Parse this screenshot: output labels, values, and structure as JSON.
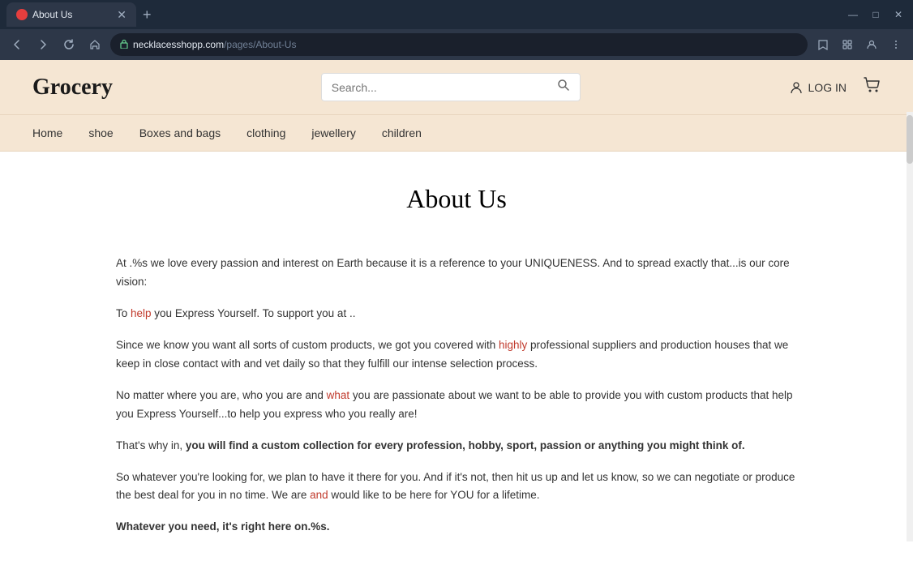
{
  "browser": {
    "tab": {
      "title": "About Us",
      "favicon_text": "●"
    },
    "url": {
      "protocol_icon": "🔒",
      "domain": "necklacesshopp.com",
      "path": "/pages/About-Us"
    },
    "nav_buttons": {
      "back": "←",
      "forward": "→",
      "refresh": "↻",
      "home": "⌂"
    },
    "window_controls": {
      "minimize": "—",
      "maximize": "□",
      "close": "✕"
    }
  },
  "header": {
    "logo": "Grocery",
    "search_placeholder": "Search...",
    "login_label": "LOG IN",
    "cart_icon": "cart"
  },
  "nav": {
    "items": [
      {
        "label": "Home"
      },
      {
        "label": "shoe"
      },
      {
        "label": "Boxes and bags"
      },
      {
        "label": "clothing"
      },
      {
        "label": "jewellery"
      },
      {
        "label": "children"
      }
    ]
  },
  "page": {
    "title": "About Us",
    "paragraphs": [
      {
        "id": "p1",
        "text": "At .%s we love every passion and interest on Earth because it is a reference to your UNIQUENESS. And to spread exactly that...is our core vision:"
      },
      {
        "id": "p2",
        "text": "To help you Express Yourself. To support you at .."
      },
      {
        "id": "p3",
        "text": "Since we know you want all sorts of custom products, we got you covered with highly professional suppliers and production houses that we keep in close contact with and vet daily so that they fulfill our intense selection process."
      },
      {
        "id": "p4",
        "text": "No matter where you are, who you are and what you are passionate about we want to be able to provide you with custom products that help you Express Yourself...to help you express who you really are!"
      },
      {
        "id": "p5",
        "text": "That's why in, you will find a custom collection for every profession, hobby, sport, passion or anything you might think of."
      },
      {
        "id": "p6",
        "text": "So whatever you're looking for, we plan to have it there for you. And if it's not, then hit us up and let us know, so we can negotiate or produce the best deal for you in no time. We are and would like to be here for YOU for a lifetime."
      },
      {
        "id": "p7",
        "text": "Whatever you need, it's right here on.%s."
      }
    ]
  }
}
